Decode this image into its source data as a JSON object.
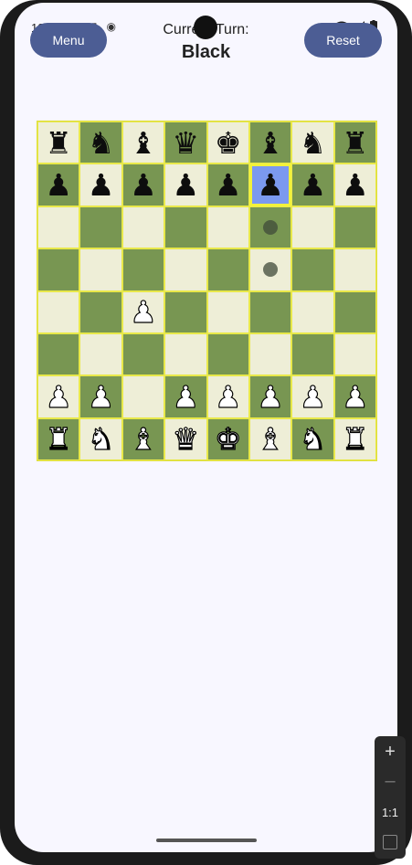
{
  "status_bar": {
    "time": "12:41"
  },
  "header": {
    "menu_label": "Menu",
    "reset_label": "Reset",
    "turn_label": "Current Turn:",
    "turn_value": "Black"
  },
  "board": {
    "rows": [
      [
        [
          "r",
          "b"
        ],
        [
          "n",
          "b"
        ],
        [
          "b",
          "b"
        ],
        [
          "q",
          "b"
        ],
        [
          "k",
          "b"
        ],
        [
          "b",
          "b"
        ],
        [
          "n",
          "b"
        ],
        [
          "r",
          "b"
        ]
      ],
      [
        [
          "p",
          "b"
        ],
        [
          "p",
          "b"
        ],
        [
          "p",
          "b"
        ],
        [
          "p",
          "b"
        ],
        [
          "p",
          "b"
        ],
        [
          "p",
          "b"
        ],
        [
          "p",
          "b"
        ],
        [
          "p",
          "b"
        ]
      ],
      [
        null,
        null,
        null,
        null,
        null,
        null,
        null,
        null
      ],
      [
        null,
        null,
        null,
        null,
        null,
        null,
        null,
        null
      ],
      [
        null,
        null,
        [
          "p",
          "w"
        ],
        null,
        null,
        null,
        null,
        null
      ],
      [
        null,
        null,
        null,
        null,
        null,
        null,
        null,
        null
      ],
      [
        [
          "p",
          "w"
        ],
        [
          "p",
          "w"
        ],
        null,
        [
          "p",
          "w"
        ],
        [
          "p",
          "w"
        ],
        [
          "p",
          "w"
        ],
        [
          "p",
          "w"
        ],
        [
          "p",
          "w"
        ]
      ],
      [
        [
          "r",
          "w"
        ],
        [
          "n",
          "w"
        ],
        [
          "b",
          "w"
        ],
        [
          "q",
          "w"
        ],
        [
          "k",
          "w"
        ],
        [
          "b",
          "w"
        ],
        [
          "n",
          "w"
        ],
        [
          "r",
          "w"
        ]
      ]
    ],
    "selected_square": [
      1,
      5
    ],
    "move_hints": [
      [
        2,
        5
      ],
      [
        3,
        5
      ]
    ],
    "colors": {
      "light": "#eeeed7",
      "dark": "#789652",
      "selected": "#7b99ef",
      "border": "#f2f23a"
    }
  },
  "zoom_panel": {
    "zoom_in": "+",
    "zoom_out": "–",
    "ratio": "1:1"
  },
  "accent_color": "#4c5d94"
}
